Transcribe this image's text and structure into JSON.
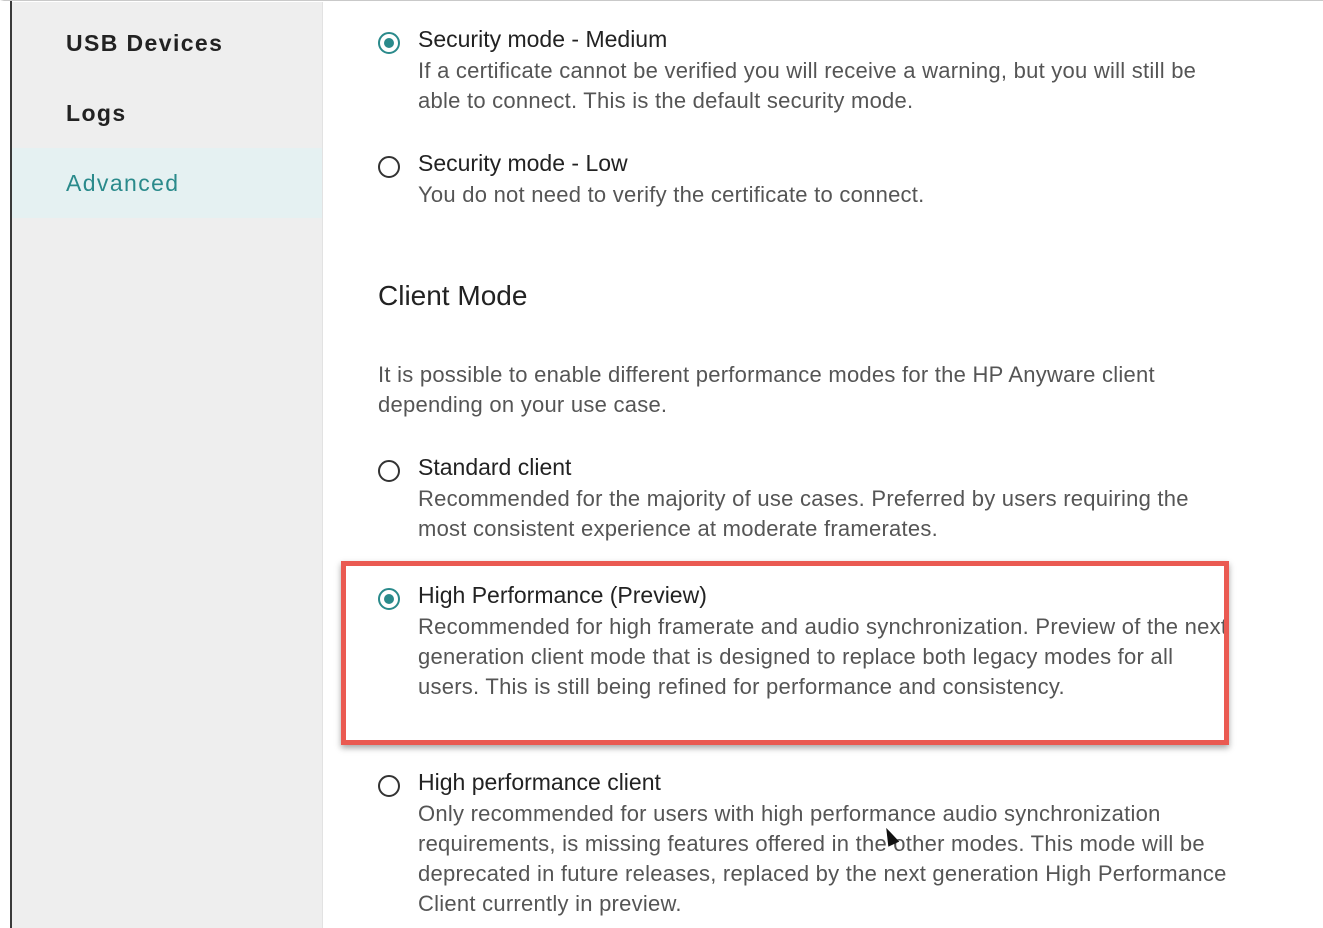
{
  "sidebar": {
    "items": [
      {
        "label": "USB Devices",
        "active": false
      },
      {
        "label": "Logs",
        "active": false
      },
      {
        "label": "Advanced",
        "active": true
      }
    ]
  },
  "security": {
    "options": [
      {
        "title": "Security mode - Medium",
        "description": "If a certificate cannot be verified you will receive a warning, but you will still be able to connect. This is the default security mode.",
        "selected": true
      },
      {
        "title": "Security mode - Low",
        "description": "You do not need to verify the certificate to connect.",
        "selected": false
      }
    ]
  },
  "client_mode": {
    "title": "Client Mode",
    "description": "It is possible to enable different performance modes for the HP Anyware client depending on your use case.",
    "options": [
      {
        "title": "Standard client",
        "description": "Recommended for the majority of use cases. Preferred by users requiring the most consistent experience at moderate framerates.",
        "selected": false
      },
      {
        "title": "High Performance (Preview)",
        "description": "Recommended for high framerate and audio synchronization. Preview of the next generation client mode that is designed to replace both legacy modes for all users. This is still being refined for performance and consistency.",
        "selected": true,
        "highlighted": true
      },
      {
        "title": "High performance client",
        "description": "Only recommended for users with high performance audio synchronization requirements, is missing features offered in the other modes. This mode will be deprecated in future releases, replaced by the next generation High Performance Client currently in preview.",
        "selected": false
      }
    ]
  },
  "colors": {
    "accent": "#2a8a8b",
    "highlight_border": "#ea5a52",
    "sidebar_bg": "#eeeeee",
    "active_item_bg": "#e5f1f2"
  }
}
